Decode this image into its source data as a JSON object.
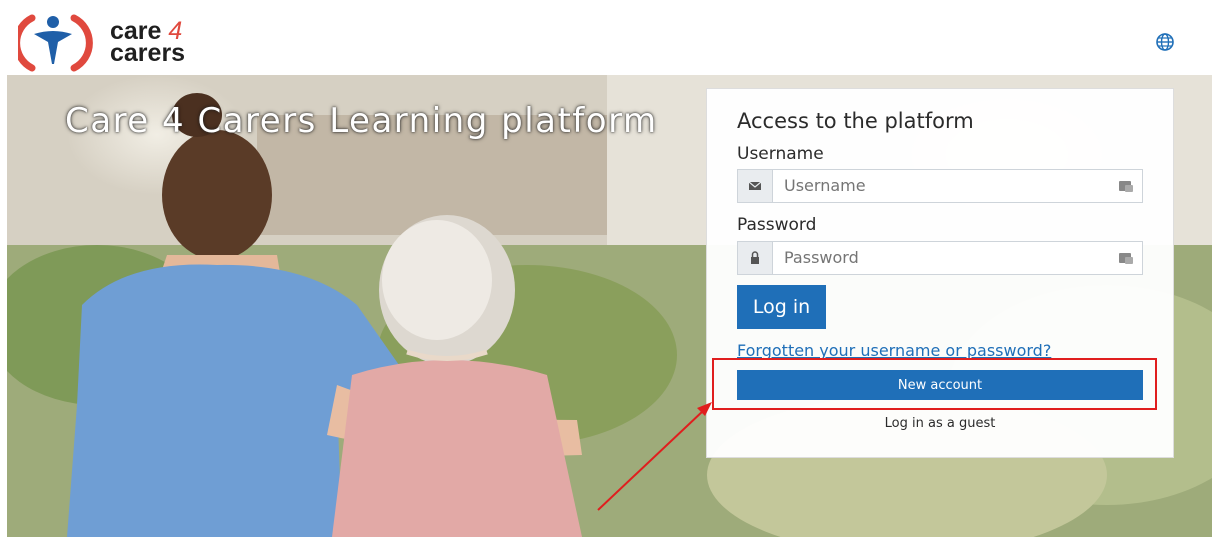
{
  "header": {
    "logo_line1": "care",
    "logo_four": "4",
    "logo_line2": "carers",
    "language_icon": "globe-icon"
  },
  "hero": {
    "title": "Care 4 Carers Learning platform"
  },
  "login": {
    "title": "Access to the platform",
    "username_label": "Username",
    "username_placeholder": "Username",
    "password_label": "Password",
    "password_placeholder": "Password",
    "login_button": "Log in",
    "forgot_link": "Forgotten your username or password?",
    "new_account_button": "New account",
    "guest_link": "Log in as a guest"
  },
  "colors": {
    "primary": "#1f6fb8",
    "highlight": "#e01e1e",
    "logo_red": "#e0493e",
    "logo_blue": "#1f5fa8"
  }
}
